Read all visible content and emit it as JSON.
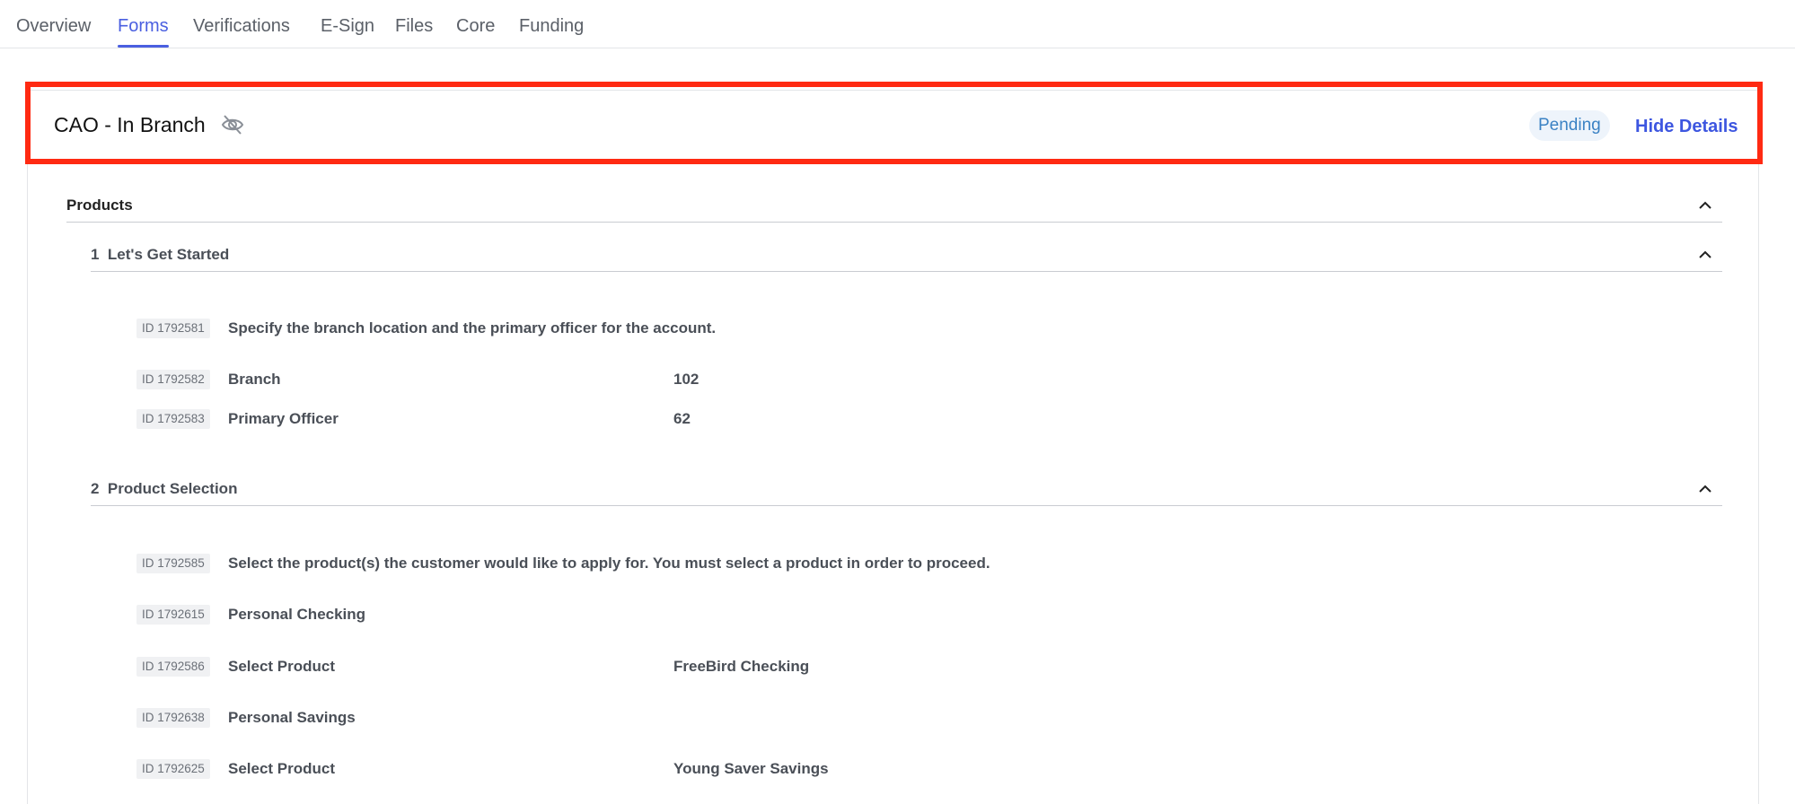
{
  "tabs": [
    {
      "label": "Overview",
      "active": false
    },
    {
      "label": "Forms",
      "active": true
    },
    {
      "label": "Verifications",
      "active": false
    },
    {
      "label": "E-Sign",
      "active": false
    },
    {
      "label": "Files",
      "active": false
    },
    {
      "label": "Core",
      "active": false
    },
    {
      "label": "Funding",
      "active": false
    }
  ],
  "card": {
    "title": "CAO - In Branch",
    "visibility_icon": "eye-off-icon",
    "status": "Pending",
    "toggle_label": "Hide Details"
  },
  "products_section": {
    "label": "Products"
  },
  "sections": [
    {
      "number": "1",
      "label": "Let's Get Started",
      "rows": [
        {
          "id": "ID 1792581",
          "label": "Specify the branch location and the primary officer for the account.",
          "value": ""
        },
        {
          "id": "ID 1792582",
          "label": "Branch",
          "value": "102"
        },
        {
          "id": "ID 1792583",
          "label": "Primary Officer",
          "value": "62"
        }
      ]
    },
    {
      "number": "2",
      "label": "Product Selection",
      "rows": [
        {
          "id": "ID 1792585",
          "label": "Select the product(s) the customer would like to apply for. You must select a product in order to proceed.",
          "value": ""
        },
        {
          "id": "ID 1792615",
          "label": "Personal Checking",
          "value": ""
        },
        {
          "id": "ID 1792586",
          "label": "Select Product",
          "value": "FreeBird Checking"
        },
        {
          "id": "ID 1792638",
          "label": "Personal Savings",
          "value": ""
        },
        {
          "id": "ID 1792625",
          "label": "Select Product",
          "value": "Young Saver Savings"
        }
      ]
    }
  ],
  "colors": {
    "accent": "#4a5fe0",
    "highlight_border": "#ff2a12",
    "pending_text": "#3b82c4",
    "pending_bg": "#eef4fb"
  }
}
